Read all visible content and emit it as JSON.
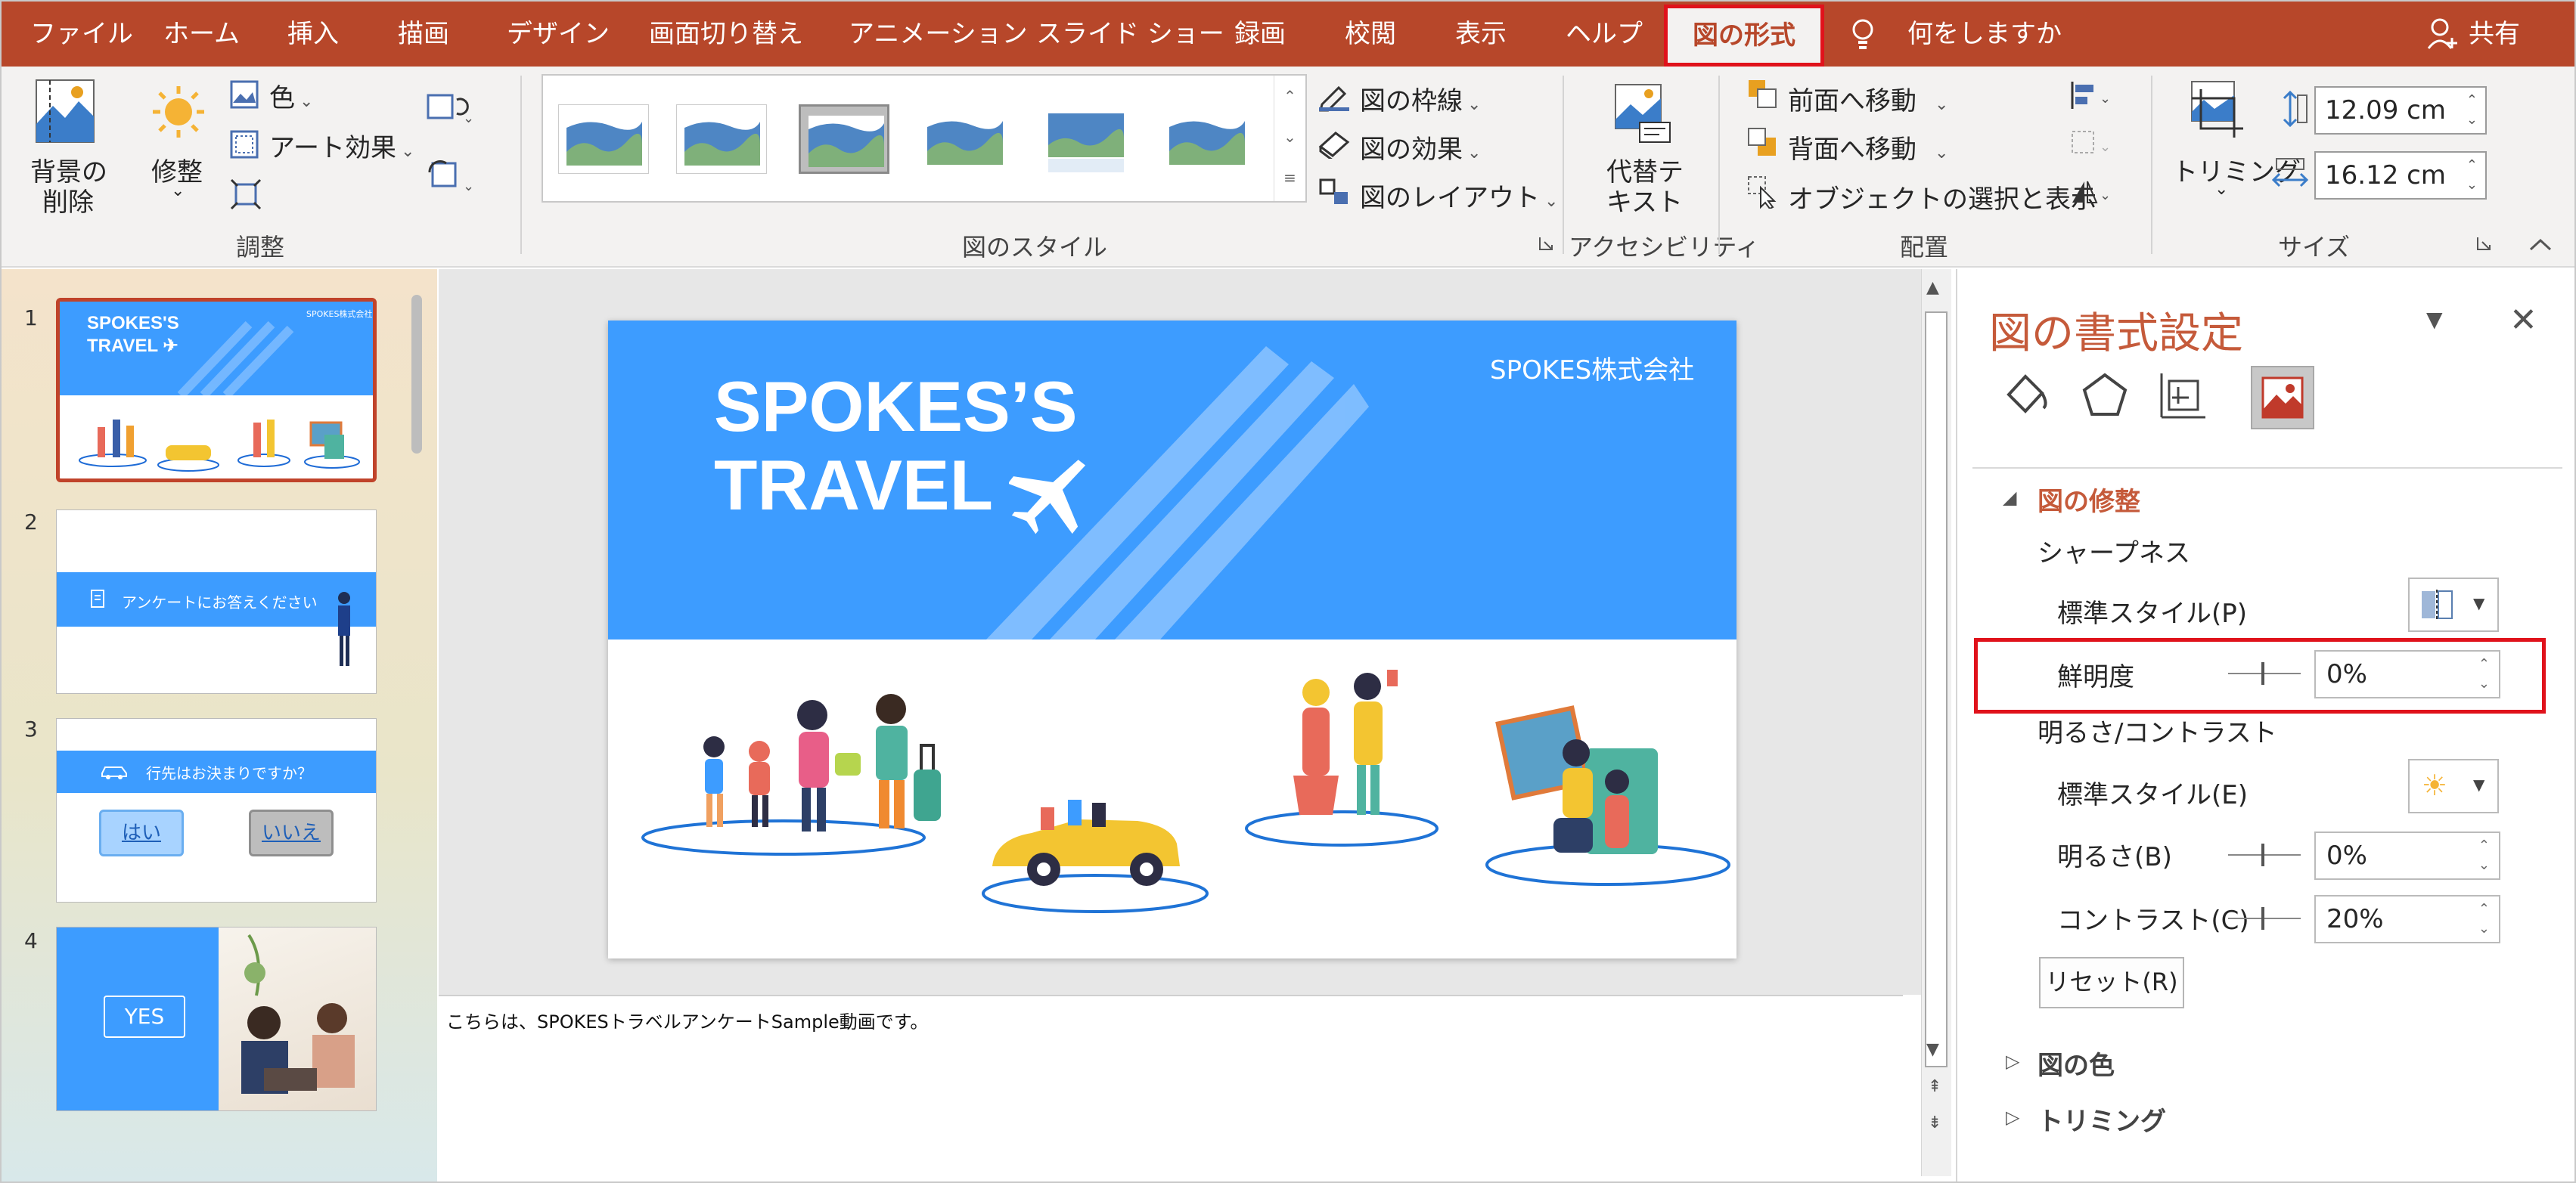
{
  "tabs": {
    "file": "ファイル",
    "home": "ホーム",
    "insert": "挿入",
    "draw": "描画",
    "design": "デザイン",
    "transitions": "画面切り替え",
    "animations": "アニメーション",
    "slideshow": "スライド ショー",
    "record": "録画",
    "review": "校閲",
    "view": "表示",
    "help": "ヘルプ",
    "picture_format": "図の形式",
    "tell_me": "何をしますか",
    "share": "共有"
  },
  "ribbon": {
    "remove_bg_1": "背景の",
    "remove_bg_2": "削除",
    "corrections": "修整",
    "color": "色",
    "artistic": "アート効果",
    "group_adjust": "調整",
    "group_styles": "図のスタイル",
    "border": "図の枠線",
    "effects": "図の効果",
    "layout": "図のレイアウト",
    "alt_text_1": "代替テ",
    "alt_text_2": "キスト",
    "group_access": "アクセシビリティ",
    "bring_forward": "前面へ移動",
    "send_backward": "背面へ移動",
    "selection_pane": "オブジェクトの選択と表示",
    "group_arrange": "配置",
    "crop": "トリミング",
    "height": "12.09 cm",
    "width": "16.12 cm",
    "group_size": "サイズ"
  },
  "slides": {
    "numbers": [
      "1",
      "2",
      "3",
      "4"
    ],
    "s1_title_1": "SPOKES'S",
    "s1_title_2": "TRAVEL",
    "s1_company": "SPOKES株式会社",
    "s2_text": "アンケートにお答えください",
    "s3_text": "行先はお決まりですか？",
    "s3_yes": "はい",
    "s3_no": "いいえ",
    "s4_yes": "YES"
  },
  "main_slide": {
    "title_1": "SPOKES’S",
    "title_2": "TRAVEL",
    "company": "SPOKES株式会社"
  },
  "notes": "こちらは、SPOKESトラベルアンケートSample動画です。",
  "format_pane": {
    "title": "図の書式設定",
    "section_correct": "図の修整",
    "sharpness": "シャープネス",
    "preset_p": "標準スタイル(P)",
    "sharpen": "鮮明度",
    "sharpen_val": "0%",
    "bright_contrast": "明るさ/コントラスト",
    "preset_e": "標準スタイル(E)",
    "brightness": "明るさ(B)",
    "brightness_val": "0%",
    "contrast": "コントラスト(C)",
    "contrast_val": "20%",
    "reset": "リセット(R)",
    "section_color": "図の色",
    "section_crop": "トリミング"
  },
  "colors": {
    "titlebar": "#b7472a",
    "highlight": "#e0121b",
    "slide_blue": "#3d9cff",
    "pane_title": "#c55a3a"
  }
}
